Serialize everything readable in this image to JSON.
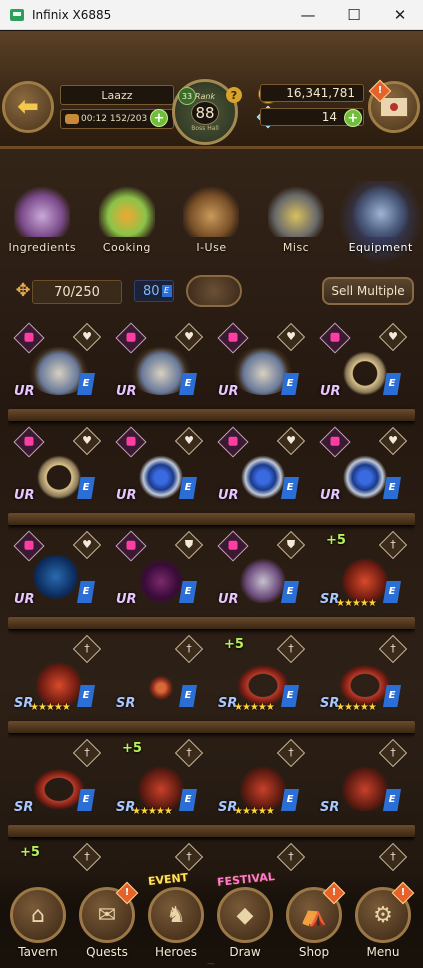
{
  "window": {
    "title": "Infinix X6885",
    "minimize": "—",
    "maximize": "☐",
    "close": "✕"
  },
  "header": {
    "player_name": "Laazz",
    "stamina_time": "00:12",
    "stamina": "152/203",
    "rank_title": "Rank",
    "rank_value": "88",
    "rank_sub": "Boss Hall",
    "rank_level": "33",
    "gold": "16,341,781",
    "gems": "14",
    "colors": {
      "accent_gold": "#f2c94c",
      "gem_blue": "#4fc6ff",
      "plus_green": "#6fbf3a"
    }
  },
  "categories": [
    {
      "label": "Ingredients",
      "icon": "ingredients-icon",
      "active": false
    },
    {
      "label": "Cooking",
      "icon": "cooking-icon",
      "active": false
    },
    {
      "label": "I-Use",
      "icon": "item-use-icon",
      "active": false
    },
    {
      "label": "Misc",
      "icon": "misc-icon",
      "active": false
    },
    {
      "label": "Equipment",
      "icon": "equipment-icon",
      "active": true
    }
  ],
  "inventory": {
    "count": "70/250",
    "enchant_count": "80",
    "enchant_letter": "E",
    "sell_label": "Sell Multiple"
  },
  "grid": [
    [
      {
        "rarity": "UR",
        "badge": "E",
        "lock": true,
        "fav": "heart",
        "item": "chain-mail-icon"
      },
      {
        "rarity": "UR",
        "badge": "E",
        "lock": true,
        "fav": "heart",
        "item": "chain-mail-icon"
      },
      {
        "rarity": "UR",
        "badge": "E",
        "lock": true,
        "fav": "heart",
        "item": "chain-mail-icon"
      },
      {
        "rarity": "UR",
        "badge": "E",
        "lock": true,
        "fav": "heart",
        "item": "ring-icon"
      }
    ],
    [
      {
        "rarity": "UR",
        "badge": "E",
        "lock": true,
        "fav": "heart",
        "item": "ring-icon"
      },
      {
        "rarity": "UR",
        "badge": "E",
        "lock": true,
        "fav": "heart",
        "item": "sapphire-ring-icon"
      },
      {
        "rarity": "UR",
        "badge": "E",
        "lock": true,
        "fav": "heart",
        "item": "sapphire-ring-icon"
      },
      {
        "rarity": "UR",
        "badge": "E",
        "lock": true,
        "fav": "heart",
        "item": "sapphire-ring-icon"
      }
    ],
    [
      {
        "rarity": "UR",
        "badge": "E",
        "lock": true,
        "fav": "heart",
        "item": "orb-icon"
      },
      {
        "rarity": "UR",
        "badge": "E",
        "lock": true,
        "fav": "shield",
        "item": "bat-wing-icon"
      },
      {
        "rarity": "UR",
        "badge": "E",
        "lock": true,
        "fav": "shield",
        "item": "spike-armor-icon"
      },
      {
        "rarity": "SR",
        "badge": "E",
        "lock": false,
        "fav": "sword",
        "item": "red-gauntlet-icon",
        "plus": "+5",
        "stars": "★★★★★"
      }
    ],
    [
      {
        "rarity": "SR",
        "badge": "E",
        "lock": false,
        "fav": "sword",
        "item": "red-gauntlet-icon",
        "stars": "★★★★★"
      },
      {
        "rarity": "SR",
        "badge": "E",
        "lock": false,
        "fav": "sword",
        "item": "amulet-icon",
        "stars": ""
      },
      {
        "rarity": "SR",
        "badge": "E",
        "lock": false,
        "fav": "sword",
        "item": "red-belt-icon",
        "plus": "+5",
        "stars": "★★★★★"
      },
      {
        "rarity": "SR",
        "badge": "E",
        "lock": false,
        "fav": "sword",
        "item": "red-belt-icon",
        "stars": "★★★★★"
      }
    ],
    [
      {
        "rarity": "SR",
        "badge": "E",
        "lock": false,
        "fav": "sword",
        "item": "red-belt-icon",
        "stars": ""
      },
      {
        "rarity": "SR",
        "badge": "E",
        "lock": false,
        "fav": "sword",
        "item": "horned-helmet-icon",
        "plus": "+5",
        "stars": "★★★★★"
      },
      {
        "rarity": "SR",
        "badge": "E",
        "lock": false,
        "fav": "sword",
        "item": "horned-helmet-icon",
        "stars": "★★★★★"
      },
      {
        "rarity": "SR",
        "badge": "E",
        "lock": false,
        "fav": "sword",
        "item": "horned-helmet-icon",
        "stars": ""
      }
    ],
    [
      {
        "rarity": "",
        "badge": "",
        "lock": false,
        "fav": "sword",
        "item": "",
        "plus": "+5"
      },
      {
        "rarity": "",
        "badge": "",
        "lock": false,
        "fav": "sword",
        "item": ""
      },
      {
        "rarity": "",
        "badge": "",
        "lock": false,
        "fav": "sword",
        "item": ""
      },
      {
        "rarity": "",
        "badge": "",
        "lock": false,
        "fav": "sword",
        "item": ""
      }
    ]
  ],
  "nav": [
    {
      "label": "Tavern",
      "icon": "tavern-icon",
      "glyph": "⌂"
    },
    {
      "label": "Quests",
      "icon": "scroll-icon",
      "glyph": "✉",
      "alert": "!"
    },
    {
      "label": "Heroes",
      "icon": "heroes-icon",
      "glyph": "♞",
      "tag": "EVENT"
    },
    {
      "label": "Draw",
      "icon": "crystal-icon",
      "glyph": "◆",
      "tag": "FESTIVAL"
    },
    {
      "label": "Shop",
      "icon": "shop-icon",
      "glyph": "⛺",
      "alert": "!"
    },
    {
      "label": "Menu",
      "icon": "gear-icon",
      "glyph": "⚙",
      "alert": "!"
    }
  ]
}
